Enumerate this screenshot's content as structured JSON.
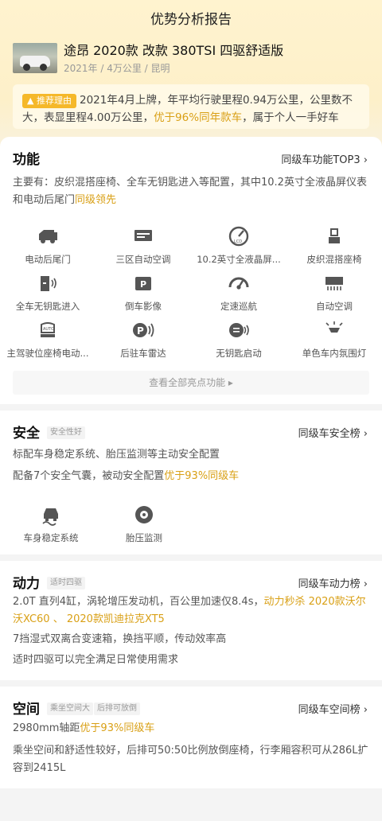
{
  "header": {
    "title": "优势分析报告"
  },
  "car": {
    "name": "途昂 2020款 改款 380TSI 四驱舒适版",
    "meta": "2021年 / 4万公里 / 昆明"
  },
  "recommend": {
    "badge": "推荐理由",
    "text_a": "2021年4月上牌，年平均行驶里程0.94万公里，公里数不大，表显里程4.00万公里，",
    "text_hl": "优于96%同年款车",
    "text_b": "，属于个人一手好车"
  },
  "function_card": {
    "title": "功能",
    "link": "同级车功能TOP3",
    "desc_a": "主要有：皮织混搭座椅、全车无钥匙进入等配置，其中10.2英寸全液晶屏仪表和电动后尾门",
    "desc_hl": "同级领先",
    "features": [
      {
        "label": "电动后尾门",
        "icon": "tailgate-icon"
      },
      {
        "label": "三区自动空调",
        "icon": "climate-icon"
      },
      {
        "label": "10.2英寸全液晶屏...",
        "icon": "lcd-gauge-icon"
      },
      {
        "label": "皮织混搭座椅",
        "icon": "seat-icon"
      },
      {
        "label": "全车无钥匙进入",
        "icon": "keyless-entry-icon"
      },
      {
        "label": "倒车影像",
        "icon": "reverse-camera-icon"
      },
      {
        "label": "定速巡航",
        "icon": "cruise-icon"
      },
      {
        "label": "自动空调",
        "icon": "auto-ac-icon"
      },
      {
        "label": "主驾驶位座椅电动...",
        "icon": "power-seat-icon"
      },
      {
        "label": "后驻车雷达",
        "icon": "parking-radar-icon"
      },
      {
        "label": "无钥匙启动",
        "icon": "keyless-start-icon"
      },
      {
        "label": "单色车内氛围灯",
        "icon": "ambient-light-icon"
      }
    ],
    "more": "查看全部亮点功能 ▸"
  },
  "safety_card": {
    "title": "安全",
    "tag": "安全性好",
    "link": "同级车安全榜",
    "line1": "标配车身稳定系统、胎压监测等主动安全配置",
    "line2_a": "配备7个安全气囊，被动安全配置",
    "line2_hl": "优于93%同级车",
    "features": [
      {
        "label": "车身稳定系统",
        "icon": "stability-icon"
      },
      {
        "label": "胎压监测",
        "icon": "tire-pressure-icon"
      }
    ]
  },
  "power_card": {
    "title": "动力",
    "tag": "适时四驱",
    "link": "同级车动力榜",
    "line1_a": "2.0T 直列4缸，涡轮增压发动机，百公里加速仅8.4s，",
    "line1_hl": "动力秒杀 2020款沃尔沃XC60",
    "line1_sep": " 、 ",
    "line1_hl2": "2020款凯迪拉克XT5",
    "line2": "7挡湿式双离合变速箱，换挡平顺，传动效率高",
    "line3": "适时四驱可以完全满足日常使用需求"
  },
  "space_card": {
    "title": "空间",
    "tag1": "乘坐空间大",
    "tag2": "后排可放倒",
    "link": "同级车空间榜",
    "line1_a": "2980mm轴距",
    "line1_hl": "优于93%同级车",
    "line2": "乘坐空间和舒适性较好，后排可50:50比例放倒座椅，行李厢容积可从286L扩容到2415L"
  },
  "colors": {
    "accent": "#d9a016",
    "badge": "#f5b829"
  }
}
